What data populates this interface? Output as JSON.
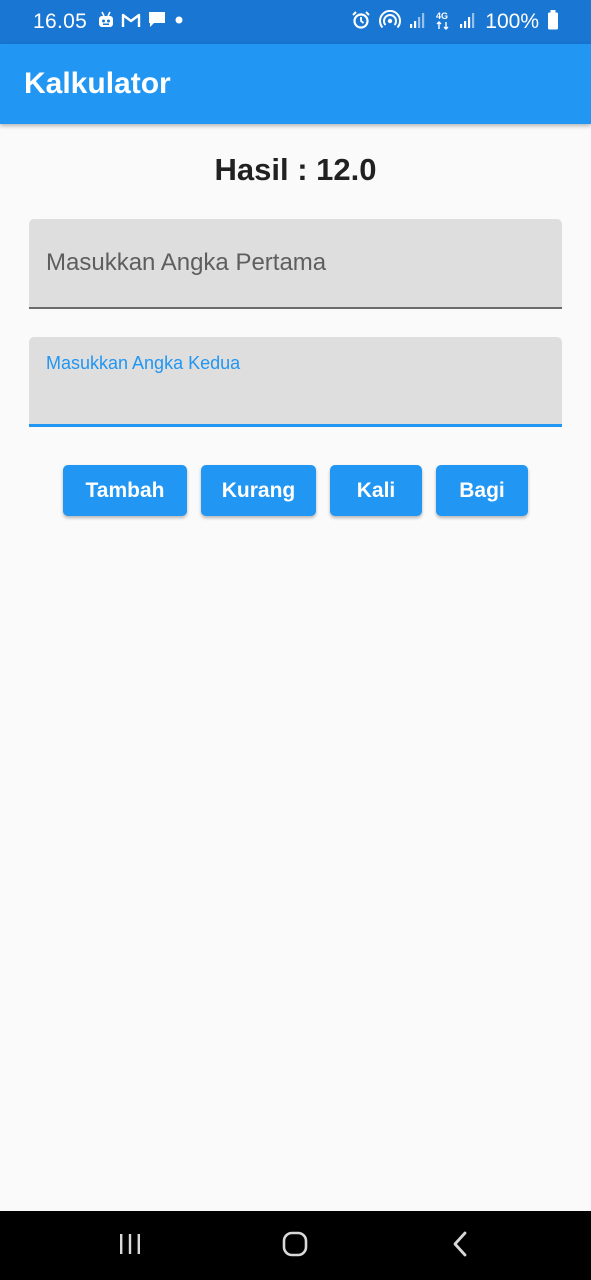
{
  "status_bar": {
    "time": "16.05",
    "battery": "100%",
    "left_icons": [
      "android-notification-icon",
      "gmail-icon",
      "message-icon",
      "dot-icon"
    ],
    "right_icons": [
      "alarm-icon",
      "hotspot-icon",
      "signal-icon",
      "4g-icon",
      "signal-icon-2",
      "battery-icon"
    ]
  },
  "app_bar": {
    "title": "Kalkulator"
  },
  "result": {
    "text": "Hasil : 12.0"
  },
  "inputs": {
    "first": {
      "placeholder": "Masukkan Angka Pertama",
      "value": ""
    },
    "second": {
      "label": "Masukkan Angka Kedua",
      "value": ""
    }
  },
  "buttons": {
    "add": "Tambah",
    "subtract": "Kurang",
    "multiply": "Kali",
    "divide": "Bagi"
  },
  "colors": {
    "status_bar": "#1976d2",
    "app_bar": "#2196f3",
    "button": "#2196f3",
    "field_fill": "#dedede",
    "background": "#fafafa"
  },
  "nav_bar": {
    "icons": [
      "recent-apps-icon",
      "home-icon",
      "back-icon"
    ]
  }
}
